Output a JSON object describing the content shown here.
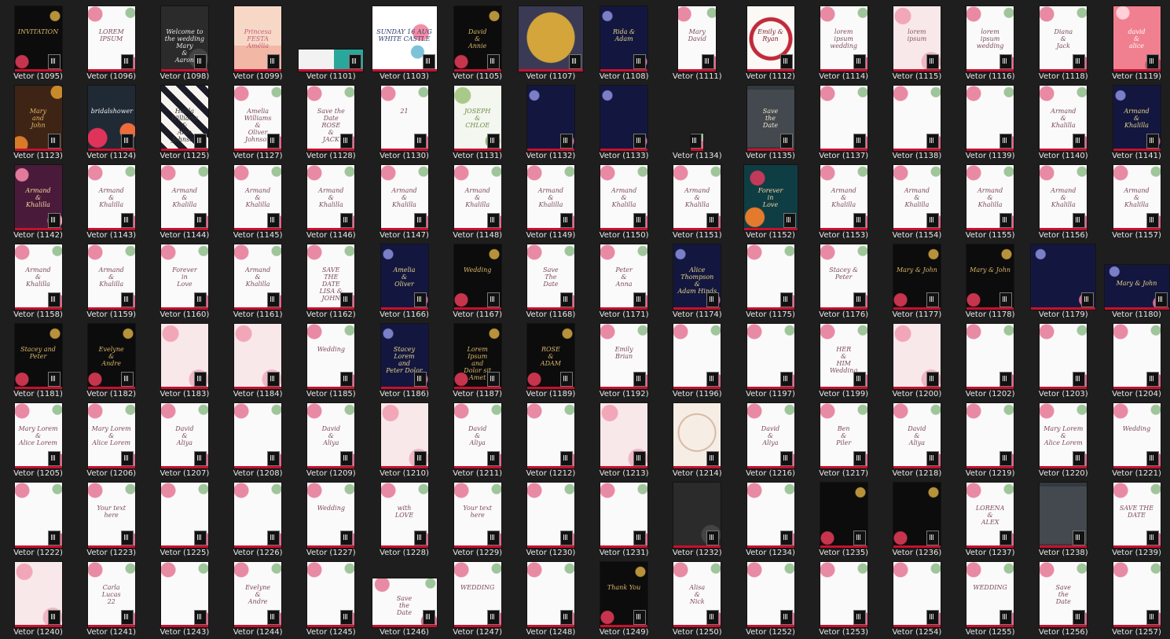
{
  "window_title": "",
  "colors": {
    "background": "#1e1e1e",
    "label_text": "#e8e8e8",
    "accent_bar": "#c8102e"
  },
  "files": [
    {
      "name": "Vetor (1095)",
      "style": "black",
      "text": "INVITATION"
    },
    {
      "name": "Vetor (1096)",
      "style": "white",
      "text": "LOREM\nIPSUM"
    },
    {
      "name": "Vetor (1098)",
      "style": "darkgray",
      "text": "Welcome to the wedding\nMary\n&\nAaron"
    },
    {
      "name": "Vetor (1099)",
      "style": "peach",
      "text": "Princesa\nFESTA\nAmélia"
    },
    {
      "name": "Vetor (1101)",
      "style": "teal",
      "text": ""
    },
    {
      "name": "Vetor (1103)",
      "style": "whitecartoon",
      "text": "SUNDAY 16 AUG\nWHITE CASTLE"
    },
    {
      "name": "Vetor (1105)",
      "style": "black",
      "text": "David\n&\nAnnie"
    },
    {
      "name": "Vetor (1107)",
      "style": "navygold",
      "text": ""
    },
    {
      "name": "Vetor (1108)",
      "style": "navy",
      "text": "Rida & Adam"
    },
    {
      "name": "Vetor (1111)",
      "style": "white",
      "text": "Mary\nDavid"
    },
    {
      "name": "Vetor (1112)",
      "style": "redwreath",
      "text": "Emily & Ryan"
    },
    {
      "name": "Vetor (1114)",
      "style": "white",
      "text": "lorem\nipsum\nwedding"
    },
    {
      "name": "Vetor (1115)",
      "style": "blush",
      "text": "lorem\nipsum"
    },
    {
      "name": "Vetor (1116)",
      "style": "white",
      "text": "lorem\nipsum\nwedding"
    },
    {
      "name": "Vetor (1118)",
      "style": "white",
      "text": "Diana\n&\nJack"
    },
    {
      "name": "Vetor (1119)",
      "style": "pink",
      "text": "david\n&\nalice"
    },
    {
      "name": "Vetor (1123)",
      "style": "brown",
      "text": "Mary\nand\nJohn"
    },
    {
      "name": "Vetor (1124)",
      "style": "darkteal",
      "text": "bridalshower"
    },
    {
      "name": "Vetor (1125)",
      "style": "stripes",
      "text": "Helda Williams\n&\nAlan Johnson"
    },
    {
      "name": "Vetor (1127)",
      "style": "white",
      "text": "Amelia Williams\n&\nOliver Johnson"
    },
    {
      "name": "Vetor (1128)",
      "style": "white",
      "text": "Save the Date\nROSE\n&\nJACK"
    },
    {
      "name": "Vetor (1130)",
      "style": "white",
      "text": "21"
    },
    {
      "name": "Vetor (1131)",
      "style": "green",
      "text": "JOSEPH\n&\nCHLOE"
    },
    {
      "name": "Vetor (1132)",
      "style": "navy",
      "text": ""
    },
    {
      "name": "Vetor (1133)",
      "style": "navy",
      "text": ""
    },
    {
      "name": "Vetor (1134)",
      "style": "white",
      "text": ""
    },
    {
      "name": "Vetor (1135)",
      "style": "darkslate",
      "text": "Save\nthe\nDate"
    },
    {
      "name": "Vetor (1137)",
      "style": "white",
      "text": ""
    },
    {
      "name": "Vetor (1138)",
      "style": "white",
      "text": ""
    },
    {
      "name": "Vetor (1139)",
      "style": "white",
      "text": ""
    },
    {
      "name": "Vetor (1140)",
      "style": "white",
      "text": "Armand\n&\nKhalilla"
    },
    {
      "name": "Vetor (1141)",
      "style": "navy",
      "text": "Armand\n&\nKhalilla"
    },
    {
      "name": "Vetor (1142)",
      "style": "plum",
      "text": "Armand\n&\nKhalilla"
    },
    {
      "name": "Vetor (1143)",
      "style": "white",
      "text": "Armand\n&\nKhalilla"
    },
    {
      "name": "Vetor (1144)",
      "style": "white",
      "text": "Armand\n&\nKhalilla"
    },
    {
      "name": "Vetor (1145)",
      "style": "white",
      "text": "Armand\n&\nKhalilla"
    },
    {
      "name": "Vetor (1146)",
      "style": "white",
      "text": "Armand\n&\nKhalilla"
    },
    {
      "name": "Vetor (1147)",
      "style": "white",
      "text": "Armand\n&\nKhalilla"
    },
    {
      "name": "Vetor (1148)",
      "style": "white",
      "text": "Armand\n&\nKhalilla"
    },
    {
      "name": "Vetor (1149)",
      "style": "white",
      "text": "Armand\n&\nKhalilla"
    },
    {
      "name": "Vetor (1150)",
      "style": "white",
      "text": "Armand\n&\nKhalilla"
    },
    {
      "name": "Vetor (1151)",
      "style": "white",
      "text": "Armand\n&\nKhalilla"
    },
    {
      "name": "Vetor (1152)",
      "style": "tealfloral",
      "text": "Forever\nin\nLove"
    },
    {
      "name": "Vetor (1153)",
      "style": "white",
      "text": "Armand\n&\nKhalilla"
    },
    {
      "name": "Vetor (1154)",
      "style": "white",
      "text": "Armand\n&\nKhalilla"
    },
    {
      "name": "Vetor (1155)",
      "style": "white",
      "text": "Armand\n&\nKhalilla"
    },
    {
      "name": "Vetor (1156)",
      "style": "white",
      "text": "Armand\n&\nKhalilla"
    },
    {
      "name": "Vetor (1157)",
      "style": "white",
      "text": "Armand\n&\nKhalilla"
    },
    {
      "name": "Vetor (1158)",
      "style": "white",
      "text": "Armand\n&\nKhalilla"
    },
    {
      "name": "Vetor (1159)",
      "style": "white",
      "text": "Armand\n&\nKhalilla"
    },
    {
      "name": "Vetor (1160)",
      "style": "white",
      "text": "Forever\nin\nLove"
    },
    {
      "name": "Vetor (1161)",
      "style": "white",
      "text": "Armand\n&\nKhalilla"
    },
    {
      "name": "Vetor (1162)",
      "style": "white",
      "text": "SAVE\nTHE\nDATE\nLISA & JOHN"
    },
    {
      "name": "Vetor (1166)",
      "style": "navy",
      "text": "Amelia\n&\nOliver"
    },
    {
      "name": "Vetor (1167)",
      "style": "black",
      "text": "Wedding"
    },
    {
      "name": "Vetor (1168)",
      "style": "white",
      "text": "Save\nThe\nDate"
    },
    {
      "name": "Vetor (1171)",
      "style": "white",
      "text": "Peter\n&\nAnna"
    },
    {
      "name": "Vetor (1174)",
      "style": "navy",
      "text": "Alice Thompson\n&\nAdam Hinds"
    },
    {
      "name": "Vetor (1175)",
      "style": "white",
      "text": ""
    },
    {
      "name": "Vetor (1176)",
      "style": "white",
      "text": "Stacey & Peter"
    },
    {
      "name": "Vetor (1177)",
      "style": "black",
      "text": "Mary & John"
    },
    {
      "name": "Vetor (1178)",
      "style": "black",
      "text": "Mary & John"
    },
    {
      "name": "Vetor (1179)",
      "style": "navy",
      "text": ""
    },
    {
      "name": "Vetor (1180)",
      "style": "navy",
      "text": "Mary & John"
    },
    {
      "name": "Vetor (1181)",
      "style": "black",
      "text": "Stacey and Peter"
    },
    {
      "name": "Vetor (1182)",
      "style": "black",
      "text": "Evelyne\n&\nAndre"
    },
    {
      "name": "Vetor (1183)",
      "style": "blush",
      "text": ""
    },
    {
      "name": "Vetor (1184)",
      "style": "blush",
      "text": ""
    },
    {
      "name": "Vetor (1185)",
      "style": "white",
      "text": "Wedding"
    },
    {
      "name": "Vetor (1186)",
      "style": "navy",
      "text": "Stacey Lorem\nand\nPeter Dolor"
    },
    {
      "name": "Vetor (1187)",
      "style": "black",
      "text": "Lorem Ipsum\nand\nDolor sit Amet"
    },
    {
      "name": "Vetor (1189)",
      "style": "black",
      "text": "ROSE\n&\nADAM"
    },
    {
      "name": "Vetor (1192)",
      "style": "white",
      "text": "Emily\nBrian"
    },
    {
      "name": "Vetor (1196)",
      "style": "white",
      "text": ""
    },
    {
      "name": "Vetor (1197)",
      "style": "white",
      "text": ""
    },
    {
      "name": "Vetor (1199)",
      "style": "white",
      "text": "HER\n&\nHIM\nWedding"
    },
    {
      "name": "Vetor (1200)",
      "style": "blush",
      "text": ""
    },
    {
      "name": "Vetor (1202)",
      "style": "white",
      "text": ""
    },
    {
      "name": "Vetor (1203)",
      "style": "white",
      "text": ""
    },
    {
      "name": "Vetor (1204)",
      "style": "white",
      "text": ""
    },
    {
      "name": "Vetor (1205)",
      "style": "white",
      "text": "Mary Lorem\n&\nAlice Lorem"
    },
    {
      "name": "Vetor (1206)",
      "style": "white",
      "text": "Mary Lorem\n&\nAlice Lorem"
    },
    {
      "name": "Vetor (1207)",
      "style": "white",
      "text": "David\n&\nAliya"
    },
    {
      "name": "Vetor (1208)",
      "style": "white",
      "text": ""
    },
    {
      "name": "Vetor (1209)",
      "style": "white",
      "text": "David\n&\nAliya"
    },
    {
      "name": "Vetor (1210)",
      "style": "blush",
      "text": ""
    },
    {
      "name": "Vetor (1211)",
      "style": "white",
      "text": "David\n&\nAliya"
    },
    {
      "name": "Vetor (1212)",
      "style": "white",
      "text": ""
    },
    {
      "name": "Vetor (1213)",
      "style": "blush",
      "text": ""
    },
    {
      "name": "Vetor (1214)",
      "style": "cream",
      "text": ""
    },
    {
      "name": "Vetor (1216)",
      "style": "white",
      "text": "David\n&\nAliya"
    },
    {
      "name": "Vetor (1217)",
      "style": "white",
      "text": "Ben\n&\nPiler"
    },
    {
      "name": "Vetor (1218)",
      "style": "white",
      "text": "David\n&\nAliya"
    },
    {
      "name": "Vetor (1219)",
      "style": "white",
      "text": ""
    },
    {
      "name": "Vetor (1220)",
      "style": "white",
      "text": "Mary Lorem\n&\nAlice Lorem"
    },
    {
      "name": "Vetor (1221)",
      "style": "white",
      "text": "Wedding"
    },
    {
      "name": "Vetor (1222)",
      "style": "white",
      "text": ""
    },
    {
      "name": "Vetor (1223)",
      "style": "white",
      "text": "Your text here"
    },
    {
      "name": "Vetor (1225)",
      "style": "white",
      "text": ""
    },
    {
      "name": "Vetor (1226)",
      "style": "white",
      "text": ""
    },
    {
      "name": "Vetor (1227)",
      "style": "white",
      "text": "Wedding"
    },
    {
      "name": "Vetor (1228)",
      "style": "white",
      "text": "with\nLOVE"
    },
    {
      "name": "Vetor (1229)",
      "style": "white",
      "text": "Your text here"
    },
    {
      "name": "Vetor (1230)",
      "style": "white",
      "text": ""
    },
    {
      "name": "Vetor (1231)",
      "style": "white",
      "text": ""
    },
    {
      "name": "Vetor (1232)",
      "style": "darkgray",
      "text": ""
    },
    {
      "name": "Vetor (1234)",
      "style": "white",
      "text": ""
    },
    {
      "name": "Vetor (1235)",
      "style": "black",
      "text": ""
    },
    {
      "name": "Vetor (1236)",
      "style": "black",
      "text": ""
    },
    {
      "name": "Vetor (1237)",
      "style": "white",
      "text": "LORENA\n&\nALEX"
    },
    {
      "name": "Vetor (1238)",
      "style": "darkslate",
      "text": ""
    },
    {
      "name": "Vetor (1239)",
      "style": "white",
      "text": "SAVE THE DATE"
    },
    {
      "name": "Vetor (1240)",
      "style": "blush",
      "text": ""
    },
    {
      "name": "Vetor (1241)",
      "style": "white",
      "text": "Carla\nLucas\n22"
    },
    {
      "name": "Vetor (1243)",
      "style": "white",
      "text": ""
    },
    {
      "name": "Vetor (1244)",
      "style": "white",
      "text": "Evelyne\n&\nAndre"
    },
    {
      "name": "Vetor (1245)",
      "style": "white",
      "text": ""
    },
    {
      "name": "Vetor (1246)",
      "style": "white",
      "text": "Save\nthe\nDate"
    },
    {
      "name": "Vetor (1247)",
      "style": "white",
      "text": "WEDDING"
    },
    {
      "name": "Vetor (1248)",
      "style": "white",
      "text": ""
    },
    {
      "name": "Vetor (1249)",
      "style": "black",
      "text": "Thank You"
    },
    {
      "name": "Vetor (1250)",
      "style": "white",
      "text": "Alisa\n&\nNick"
    },
    {
      "name": "Vetor (1252)",
      "style": "white",
      "text": ""
    },
    {
      "name": "Vetor (1253)",
      "style": "white",
      "text": ""
    },
    {
      "name": "Vetor (1254)",
      "style": "white",
      "text": ""
    },
    {
      "name": "Vetor (1255)",
      "style": "white",
      "text": "WEDDING"
    },
    {
      "name": "Vetor (1256)",
      "style": "white",
      "text": "Save\nthe\nDate"
    },
    {
      "name": "Vetor (1257)",
      "style": "white",
      "text": ""
    }
  ]
}
